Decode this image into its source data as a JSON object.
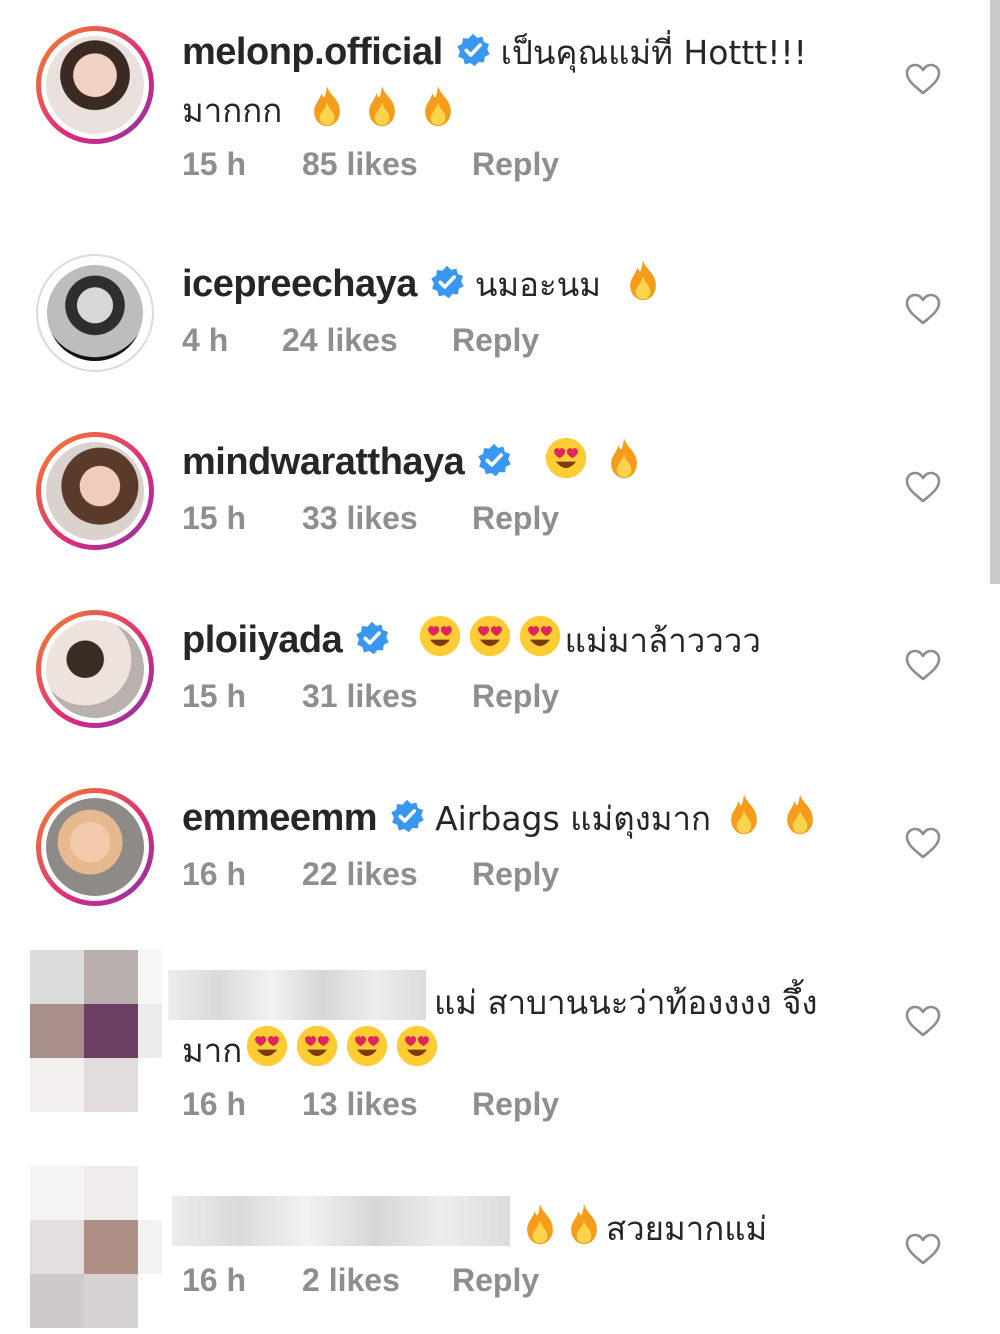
{
  "colors": {
    "verified": "#3897f0",
    "meta_text": "#8e8e8e",
    "text": "#262626",
    "ring_gradient": [
      "#f58529",
      "#dd2a7b",
      "#8134af"
    ]
  },
  "comments": [
    {
      "username": "melonp.official",
      "verified": true,
      "text_line1": "เป็นคุณแม่ที่ Hottt!!!",
      "text_line2": "มากกก",
      "emojis_line2": [
        "fire",
        "fire",
        "fire"
      ],
      "time": "15 h",
      "likes": "85 likes",
      "reply": "Reply"
    },
    {
      "username": "icepreechaya",
      "verified": true,
      "text": "นมอะนม",
      "emojis": [
        "fire"
      ],
      "time": "4 h",
      "likes": "24 likes",
      "reply": "Reply"
    },
    {
      "username": "mindwaratthaya",
      "verified": true,
      "text": "",
      "emojis": [
        "heart-eyes",
        "fire"
      ],
      "time": "15 h",
      "likes": "33 likes",
      "reply": "Reply"
    },
    {
      "username": "ploiiyada",
      "verified": true,
      "emojis": [
        "heart-eyes",
        "heart-eyes",
        "heart-eyes"
      ],
      "text": "แม่มาล้าวววว",
      "time": "15 h",
      "likes": "31 likes",
      "reply": "Reply"
    },
    {
      "username": "emmeemm",
      "verified": true,
      "text": "Airbags แม่ตุงมาก",
      "emojis": [
        "fire",
        "fire"
      ],
      "time": "16 h",
      "likes": "22 likes",
      "reply": "Reply"
    },
    {
      "username": "",
      "blurred": true,
      "text_line1": "แม่ สาบานนะว่าท้องงงง จึ้ง",
      "text_line2": "มาก",
      "emojis_line2": [
        "heart-eyes",
        "heart-eyes",
        "heart-eyes",
        "heart-eyes"
      ],
      "time": "16 h",
      "likes": "13 likes",
      "reply": "Reply"
    },
    {
      "username": "",
      "blurred": true,
      "emojis": [
        "fire",
        "fire"
      ],
      "text": "สวยมากแม่",
      "time": "16 h",
      "likes": "2 likes",
      "reply": "Reply"
    }
  ]
}
